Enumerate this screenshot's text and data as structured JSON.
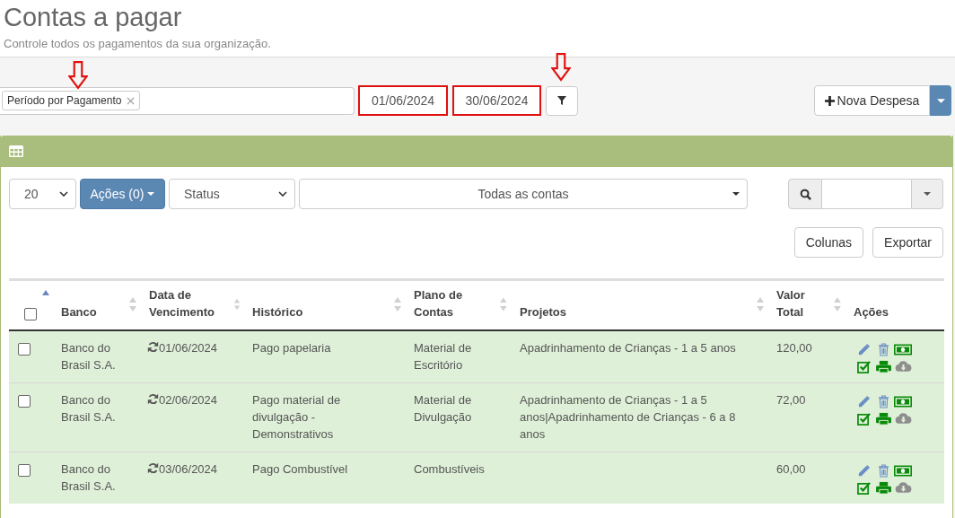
{
  "header": {
    "title": "Contas a pagar",
    "subtitle": "Controle todos os pagamentos da sua organização."
  },
  "filter": {
    "tag": "Período por Pagamento",
    "date_from": "01/06/2024",
    "date_to": "30/06/2024",
    "highlighted": true,
    "new_button": "Nova Despesa"
  },
  "toolbar": {
    "page_size": "20",
    "actions_button": "Ações (0)",
    "status_select": "Status",
    "accounts_select": "Todas as contas",
    "columns_button": "Colunas",
    "export_button": "Exportar"
  },
  "table": {
    "select_all": {
      "checked": false
    },
    "columns": [
      {
        "label": "Banco",
        "sortable": true
      },
      {
        "label": "Data de Vencimento",
        "sortable": true
      },
      {
        "label": "Histórico",
        "sortable": true
      },
      {
        "label": "Plano de Contas",
        "sortable": true
      },
      {
        "label": "Projetos",
        "sortable": true
      },
      {
        "label": "Valor Total",
        "sortable": true
      },
      {
        "label": "Ações",
        "sortable": false
      }
    ],
    "rows": [
      {
        "checked": false,
        "recurring": true,
        "banco": "Banco do Brasil S.A.",
        "vencimento": "01/06/2024",
        "historico": "Pago papelaria",
        "plano": "Material de Escritório",
        "projetos": "Apadrinhamento de Crianças - 1 a 5 anos",
        "valor": "120,00"
      },
      {
        "checked": false,
        "recurring": true,
        "banco": "Banco do Brasil S.A.",
        "vencimento": "02/06/2024",
        "historico": "Pago material de divulgação - Demonstrativos",
        "plano": "Material de Divulgação",
        "projetos": "Apadrinhamento de Crianças - 1 a 5 anos|Apadrinhamento de Crianças - 6 a 8 anos",
        "valor": "72,00"
      },
      {
        "checked": false,
        "recurring": true,
        "banco": "Banco do Brasil S.A.",
        "vencimento": "03/06/2024",
        "historico": "Pago Combustível",
        "plano": "Combustíveis",
        "valor": "60,00"
      }
    ]
  }
}
